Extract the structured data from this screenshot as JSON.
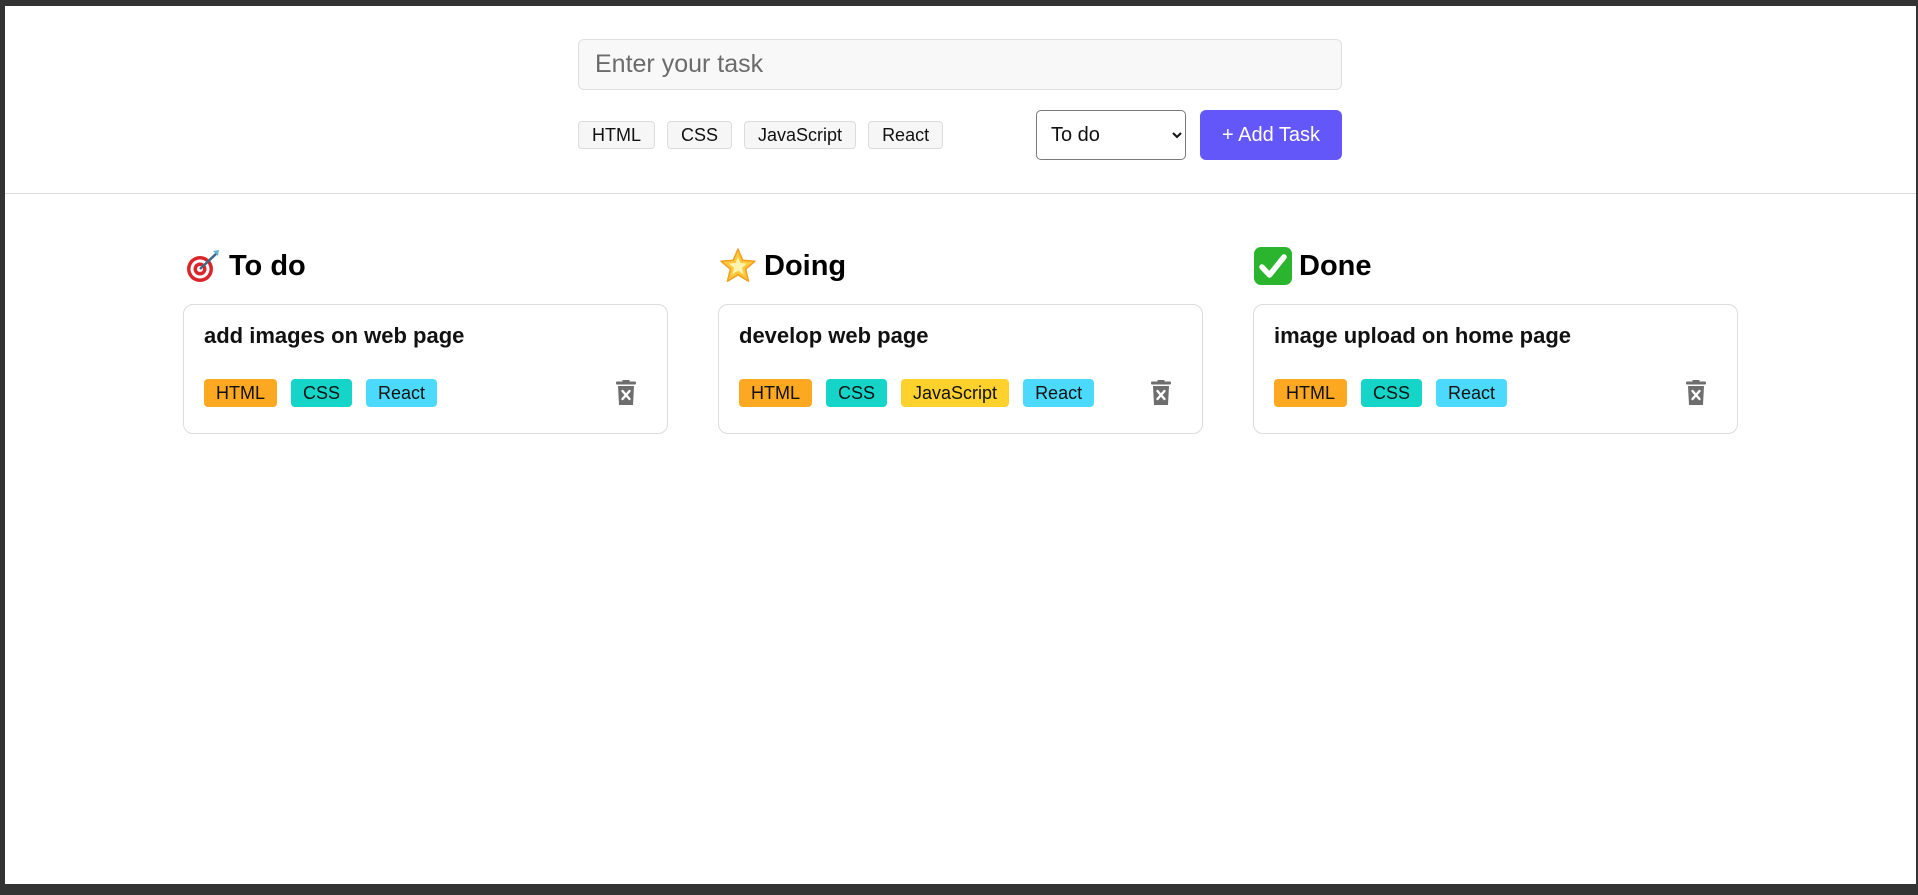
{
  "form": {
    "input_placeholder": "Enter your task",
    "tags": [
      "HTML",
      "CSS",
      "JavaScript",
      "React"
    ],
    "status_selected": "To do",
    "add_button": "+ Add Task"
  },
  "tag_colors": {
    "HTML": "#fda821",
    "CSS": "#15d4c8",
    "JavaScript": "#ffd12c",
    "React": "#4cdafc"
  },
  "columns": [
    {
      "title": "To do",
      "icon": "direct-hit-icon",
      "cards": [
        {
          "title": "add images on web page",
          "tags": [
            "HTML",
            "CSS",
            "React"
          ]
        }
      ]
    },
    {
      "title": "Doing",
      "icon": "glowing-star-icon",
      "cards": [
        {
          "title": "develop web page",
          "tags": [
            "HTML",
            "CSS",
            "JavaScript",
            "React"
          ]
        }
      ]
    },
    {
      "title": "Done",
      "icon": "check-mark-button-icon",
      "cards": [
        {
          "title": "image upload on home page",
          "tags": [
            "HTML",
            "CSS",
            "React"
          ]
        }
      ]
    }
  ]
}
